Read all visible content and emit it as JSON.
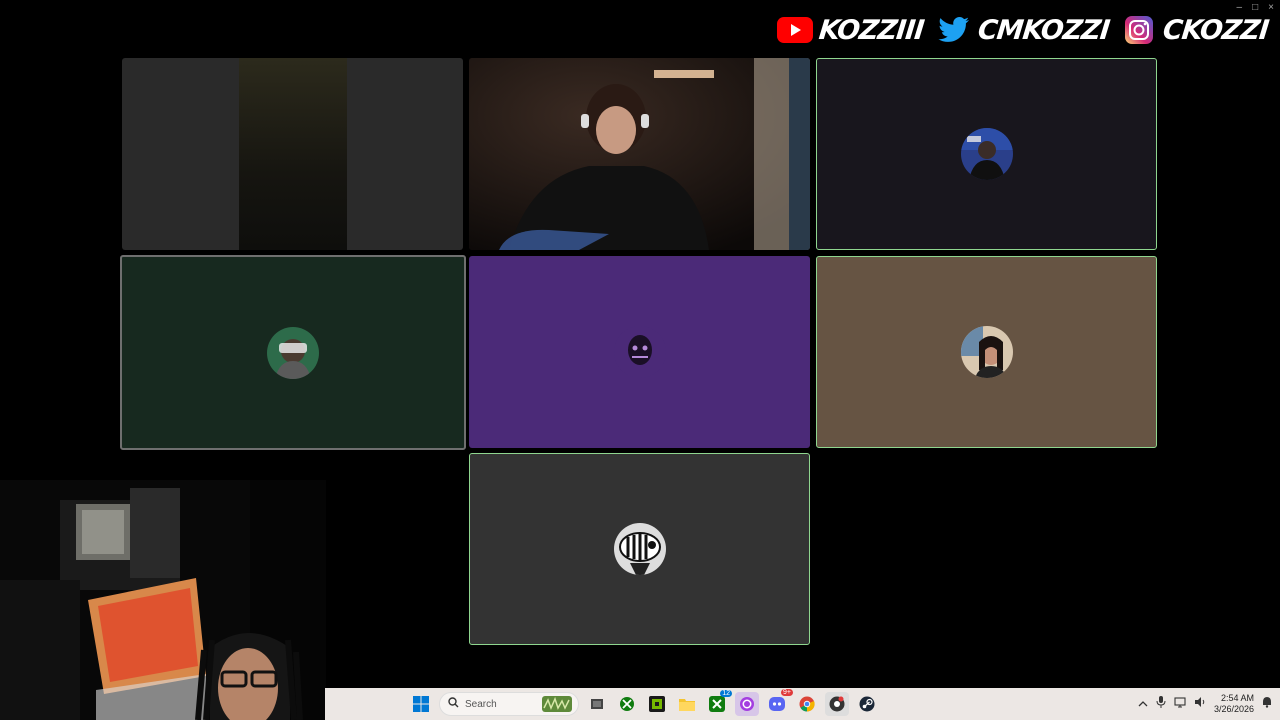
{
  "window": {
    "controls": [
      "–",
      "□",
      "×"
    ]
  },
  "social": {
    "items": [
      {
        "platform": "youtube-icon",
        "handle": "KOZZIII",
        "color": "#ff0000"
      },
      {
        "platform": "twitter-icon",
        "handle": "CMKOZZI",
        "color": "#1da1f2"
      },
      {
        "platform": "instagram-icon",
        "handle": "CKOZZI",
        "color": "#d62976"
      }
    ]
  },
  "call": {
    "tiles": [
      {
        "id": "tile-1",
        "kind": "video",
        "active": false,
        "bg": "#2a2a2a"
      },
      {
        "id": "tile-2",
        "kind": "video",
        "active": false,
        "bg": "#120d0b"
      },
      {
        "id": "tile-3",
        "kind": "avatar",
        "active": true,
        "bg": "#18161d"
      },
      {
        "id": "tile-4",
        "kind": "avatar",
        "active": false,
        "bg": "#17291f"
      },
      {
        "id": "tile-5",
        "kind": "avatar",
        "active": false,
        "bg": "#4b2a78"
      },
      {
        "id": "tile-6",
        "kind": "avatar",
        "active": true,
        "bg": "#665443"
      },
      {
        "id": "tile-7",
        "kind": "avatar",
        "active": true,
        "bg": "#333333"
      }
    ]
  },
  "taskbar": {
    "search_placeholder": "Search",
    "apps": [
      "windows-start-icon",
      "search-icon",
      "task-view-icon",
      "xbox-icon",
      "nvidia-icon",
      "file-explorer-icon",
      "xbox-app-icon",
      "obs-icon",
      "discord-icon",
      "chrome-icon",
      "chrome-dev-icon",
      "steam-icon"
    ],
    "badges": {
      "xbox_app": "12",
      "discord": "9+"
    },
    "tray": [
      "chevron-up-icon",
      "microphone-icon",
      "network-icon",
      "volume-icon"
    ],
    "time": "2:54 AM",
    "date": "3/26/2026"
  }
}
